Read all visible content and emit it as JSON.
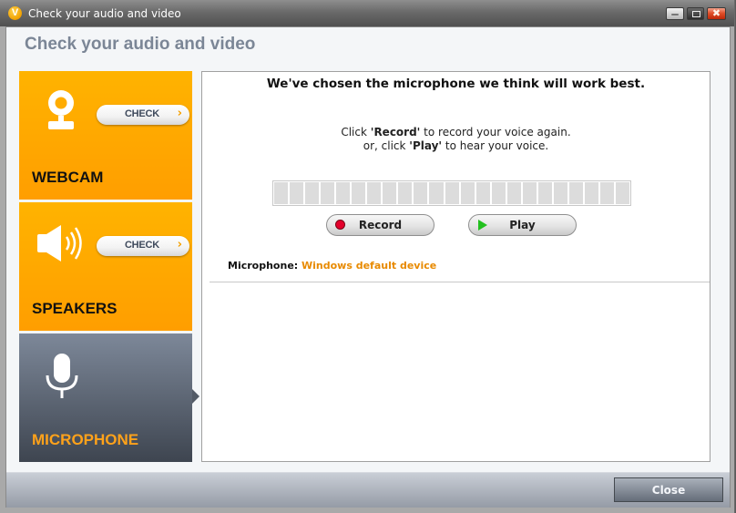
{
  "window": {
    "title": "Check your audio and video",
    "logo_letter": "V",
    "controls": [
      "minimize",
      "maximize",
      "close"
    ]
  },
  "page": {
    "title": "Check your audio and video"
  },
  "sidebar": {
    "tiles": [
      {
        "id": "webcam",
        "label": "WEBCAM",
        "icon": "webcam-icon",
        "button_label": "CHECK",
        "selected": false
      },
      {
        "id": "speakers",
        "label": "SPEAKERS",
        "icon": "speaker-icon",
        "button_label": "CHECK",
        "selected": false
      },
      {
        "id": "microphone",
        "label": "MICROPHONE",
        "icon": "microphone-icon",
        "selected": true
      }
    ]
  },
  "panel": {
    "headline": "We've chosen the microphone we think will work best.",
    "instructions": {
      "line1_prefix": "Click ",
      "line1_bold": "'Record'",
      "line1_suffix": " to record your voice again.",
      "line2_prefix": "or, click ",
      "line2_bold": "'Play'",
      "line2_suffix": " to hear your voice."
    },
    "level_meter": {
      "segments": 23,
      "level": 0
    },
    "record_label": "Record",
    "play_label": "Play",
    "microphone_label": "Microphone:",
    "microphone_device": "Windows default device"
  },
  "footer": {
    "close_label": "Close"
  },
  "colors": {
    "accent_orange": "#ffa500",
    "selected_tile": "#5a6370",
    "device_text": "#e88a00",
    "record_red": "#e4002b",
    "play_green": "#22c01e"
  }
}
